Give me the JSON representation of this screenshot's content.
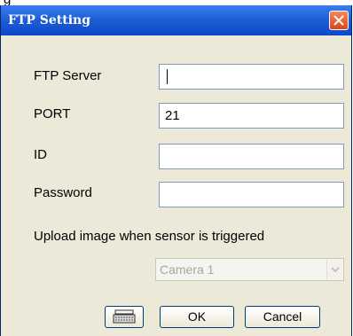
{
  "clipped_text": "g",
  "window": {
    "title": "FTP Setting"
  },
  "fields": [
    {
      "label": "FTP Server",
      "value": ""
    },
    {
      "label": "PORT",
      "value": "21"
    },
    {
      "label": "ID",
      "value": ""
    },
    {
      "label": "Password",
      "value": ""
    }
  ],
  "upload": {
    "label": "Upload image when sensor is triggered",
    "camera_selected": "Camera 1"
  },
  "buttons": {
    "keyboard_icon": "keyboard-icon",
    "ok": "OK",
    "cancel": "Cancel"
  }
}
